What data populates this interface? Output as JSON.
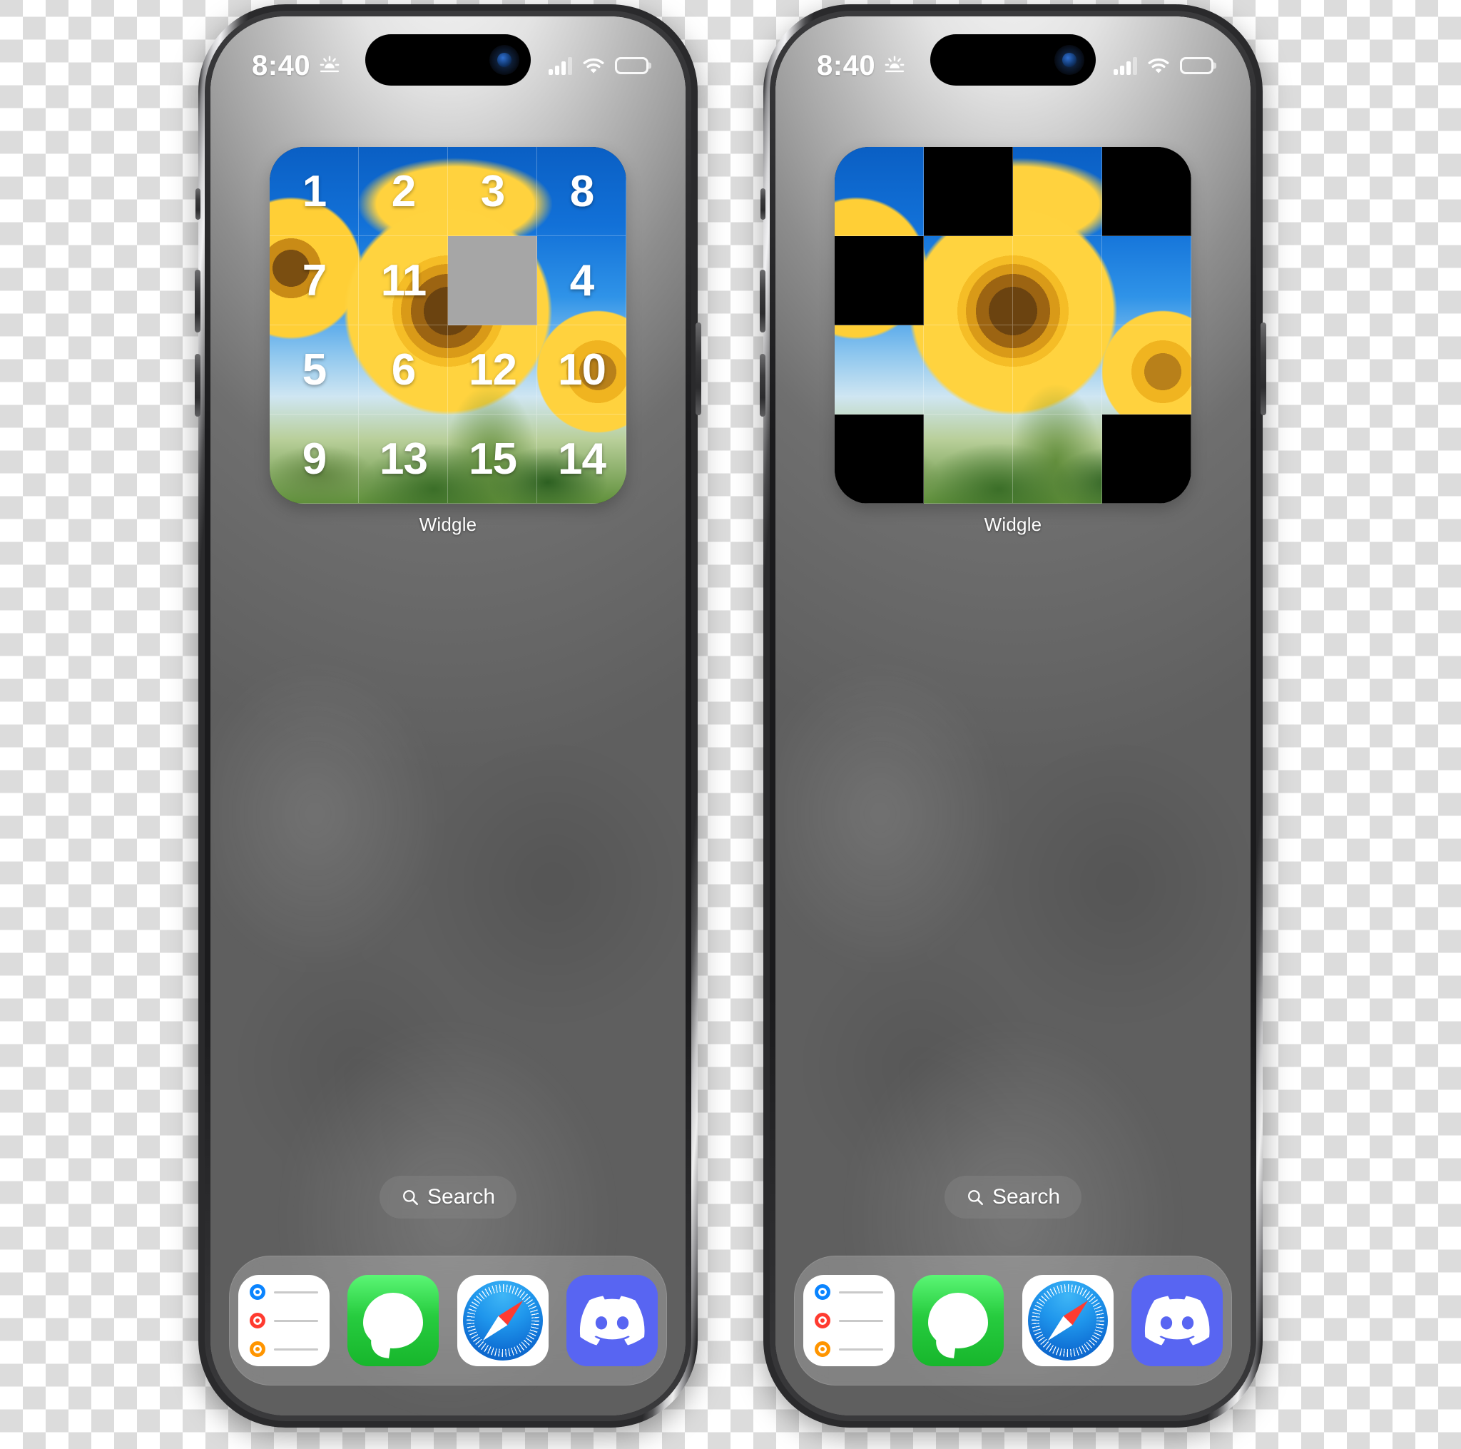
{
  "background": {
    "accent": "#5865f2",
    "wallpaper": "grey-blurred"
  },
  "phones": [
    {
      "id": "left",
      "status_bar": {
        "time": "8:40",
        "icons": [
          "sunrise-icon",
          "cellular-bars-icon",
          "wifi-icon",
          "battery-icon"
        ],
        "cellular_bars": 3,
        "battery_level": 100
      },
      "widget": {
        "label": "Widgle",
        "state": "scrambled",
        "grid_size": 4,
        "tiles": [
          {
            "num": "1",
            "kind": "image"
          },
          {
            "num": "2",
            "kind": "image"
          },
          {
            "num": "3",
            "kind": "image"
          },
          {
            "num": "8",
            "kind": "image"
          },
          {
            "num": "7",
            "kind": "image"
          },
          {
            "num": "11",
            "kind": "image"
          },
          {
            "num": "",
            "kind": "blank"
          },
          {
            "num": "4",
            "kind": "image"
          },
          {
            "num": "5",
            "kind": "image"
          },
          {
            "num": "6",
            "kind": "image"
          },
          {
            "num": "12",
            "kind": "image"
          },
          {
            "num": "10",
            "kind": "image"
          },
          {
            "num": "9",
            "kind": "image"
          },
          {
            "num": "13",
            "kind": "image"
          },
          {
            "num": "15",
            "kind": "image"
          },
          {
            "num": "14",
            "kind": "image"
          }
        ]
      },
      "search": {
        "label": "Search",
        "icon": "search-icon"
      },
      "dock": [
        {
          "name": "Reminders",
          "icon": "reminders-icon"
        },
        {
          "name": "Messages",
          "icon": "messages-icon"
        },
        {
          "name": "Safari",
          "icon": "safari-icon"
        },
        {
          "name": "Discord",
          "icon": "discord-icon"
        }
      ]
    },
    {
      "id": "right",
      "status_bar": {
        "time": "8:40",
        "icons": [
          "sunrise-icon",
          "cellular-bars-icon",
          "wifi-icon",
          "battery-icon"
        ],
        "cellular_bars": 3,
        "battery_level": 100
      },
      "widget": {
        "label": "Widgle",
        "state": "checkerboard",
        "grid_size": 4,
        "tiles": [
          {
            "num": "",
            "kind": "image"
          },
          {
            "num": "",
            "kind": "black"
          },
          {
            "num": "",
            "kind": "image"
          },
          {
            "num": "",
            "kind": "black"
          },
          {
            "num": "",
            "kind": "black"
          },
          {
            "num": "",
            "kind": "image"
          },
          {
            "num": "",
            "kind": "image"
          },
          {
            "num": "",
            "kind": "image"
          },
          {
            "num": "",
            "kind": "image"
          },
          {
            "num": "",
            "kind": "image"
          },
          {
            "num": "",
            "kind": "image"
          },
          {
            "num": "",
            "kind": "image"
          },
          {
            "num": "",
            "kind": "black"
          },
          {
            "num": "",
            "kind": "image"
          },
          {
            "num": "",
            "kind": "image"
          },
          {
            "num": "",
            "kind": "black"
          }
        ]
      },
      "search": {
        "label": "Search",
        "icon": "search-icon"
      },
      "dock": [
        {
          "name": "Reminders",
          "icon": "reminders-icon"
        },
        {
          "name": "Messages",
          "icon": "messages-icon"
        },
        {
          "name": "Safari",
          "icon": "safari-icon"
        },
        {
          "name": "Discord",
          "icon": "discord-icon"
        }
      ]
    }
  ]
}
